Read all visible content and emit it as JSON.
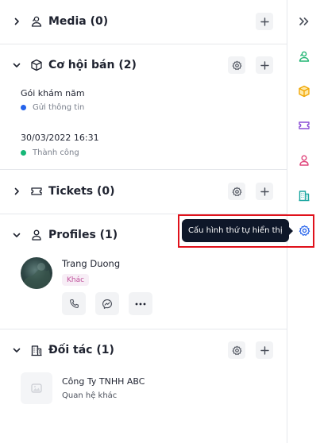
{
  "sections": {
    "media": {
      "title": "Media (0)"
    },
    "co_hoi_ban": {
      "title": "Cơ hội bán (2)",
      "items": [
        {
          "title": "Gói khám năm",
          "status": "Gửi thông tin",
          "status_color": "#2563eb"
        },
        {
          "title": "30/03/2022 16:31",
          "status": "Thành công",
          "status_color": "#16b777"
        }
      ]
    },
    "tickets": {
      "title": "Tickets (0)"
    },
    "profiles": {
      "title": "Profiles (1)",
      "profile": {
        "name": "Trang Duong",
        "tag": "Khác"
      }
    },
    "doi_tac": {
      "title": "Đối tác (1)",
      "company": {
        "name": "Công Ty TNHH ABC",
        "relation": "Quan hệ khác"
      }
    }
  },
  "tooltip": {
    "text": "Cấu hình thứ tự hiển thị"
  },
  "rail": {
    "icons": [
      "double-chevron-right-icon",
      "media-icon",
      "box-icon",
      "ticket-icon",
      "profile-icon",
      "building-icon",
      "gear-icon"
    ]
  },
  "colors": {
    "accent_blue": "#2563eb",
    "success_green": "#16b777",
    "rail_green": "#22b573",
    "rail_orange": "#f0a500",
    "rail_purple": "#8b4fd6",
    "rail_pink": "#e0457b",
    "rail_teal": "#1aa6a0",
    "tooltip_bg": "#0e1729",
    "highlight_red": "#e0111b"
  }
}
